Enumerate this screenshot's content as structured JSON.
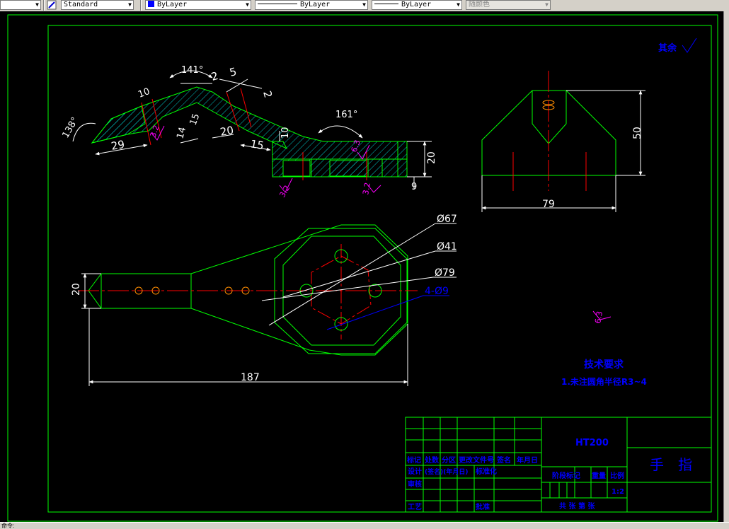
{
  "toolbar": {
    "textstyle": "Standard",
    "layer": "ByLayer",
    "linetype": "ByLayer",
    "lineweight": "ByLayer",
    "plotstyle": "随颜色"
  },
  "drawing": {
    "dims": {
      "d141": "141°",
      "d2a": "2",
      "d5": "5",
      "d2b": "2",
      "d10a": "10",
      "d138": "138°",
      "d29": "29",
      "d14": "14",
      "d15a": "15",
      "d20a": "20",
      "d15b": "15",
      "d10b": "10",
      "d161": "161°",
      "d20b": "20",
      "d9": "9",
      "d50": "50",
      "d79": "79",
      "d20c": "20",
      "d187": "187",
      "dia67": "Ø67",
      "dia41": "Ø41",
      "dia79": "Ø79",
      "holes": "4-Ø9"
    },
    "roughness": {
      "r32a": "3.2",
      "r63a": "6.3",
      "r32b": "3.2",
      "r32c": "3.2",
      "r63b": "6.3",
      "other": "其余"
    },
    "notes": {
      "heading": "技术要求",
      "line1": "1.未注圆角半径R3~4"
    },
    "titleblock": {
      "material": "HT200",
      "name": "手　指",
      "headers": [
        "标记",
        "处数",
        "分区",
        "更改文件号",
        "签名",
        "年月日"
      ],
      "design": "设计",
      "standard": "标准化",
      "check": "审核",
      "craft": "工艺",
      "approve": "批准",
      "date_sig": "(签名)(年月日)",
      "stage_mark": "阶段标记",
      "weight": "重量",
      "scale": "比例",
      "scale_value": "1:2",
      "sheets": "共 张   第 张"
    }
  },
  "status": {
    "command": "命令:"
  }
}
